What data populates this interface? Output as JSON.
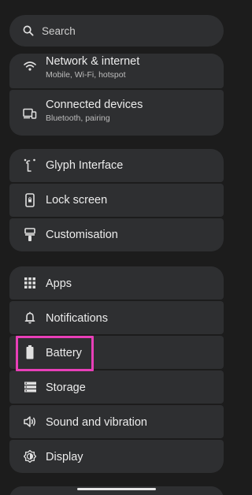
{
  "search": {
    "placeholder": "Search",
    "icon": "search-icon"
  },
  "groups": [
    {
      "items": [
        {
          "title": "Network & internet",
          "subtitle": "Mobile, Wi-Fi, hotspot",
          "icon": "wifi-icon"
        },
        {
          "title": "Connected devices",
          "subtitle": "Bluetooth, pairing",
          "icon": "devices-icon"
        }
      ]
    },
    {
      "items": [
        {
          "title": "Glyph Interface",
          "icon": "glyph-icon"
        },
        {
          "title": "Lock screen",
          "icon": "lock-screen-icon"
        },
        {
          "title": "Customisation",
          "icon": "brush-icon"
        }
      ]
    },
    {
      "items": [
        {
          "title": "Apps",
          "icon": "apps-grid-icon"
        },
        {
          "title": "Notifications",
          "icon": "bell-icon"
        },
        {
          "title": "Battery",
          "icon": "battery-icon"
        },
        {
          "title": "Storage",
          "icon": "storage-icon"
        },
        {
          "title": "Sound and vibration",
          "icon": "speaker-icon"
        },
        {
          "title": "Display",
          "icon": "display-icon"
        }
      ]
    }
  ],
  "colors": {
    "background": "#1c1c1c",
    "card": "#2e2f31",
    "highlight": "#e83fb8"
  }
}
